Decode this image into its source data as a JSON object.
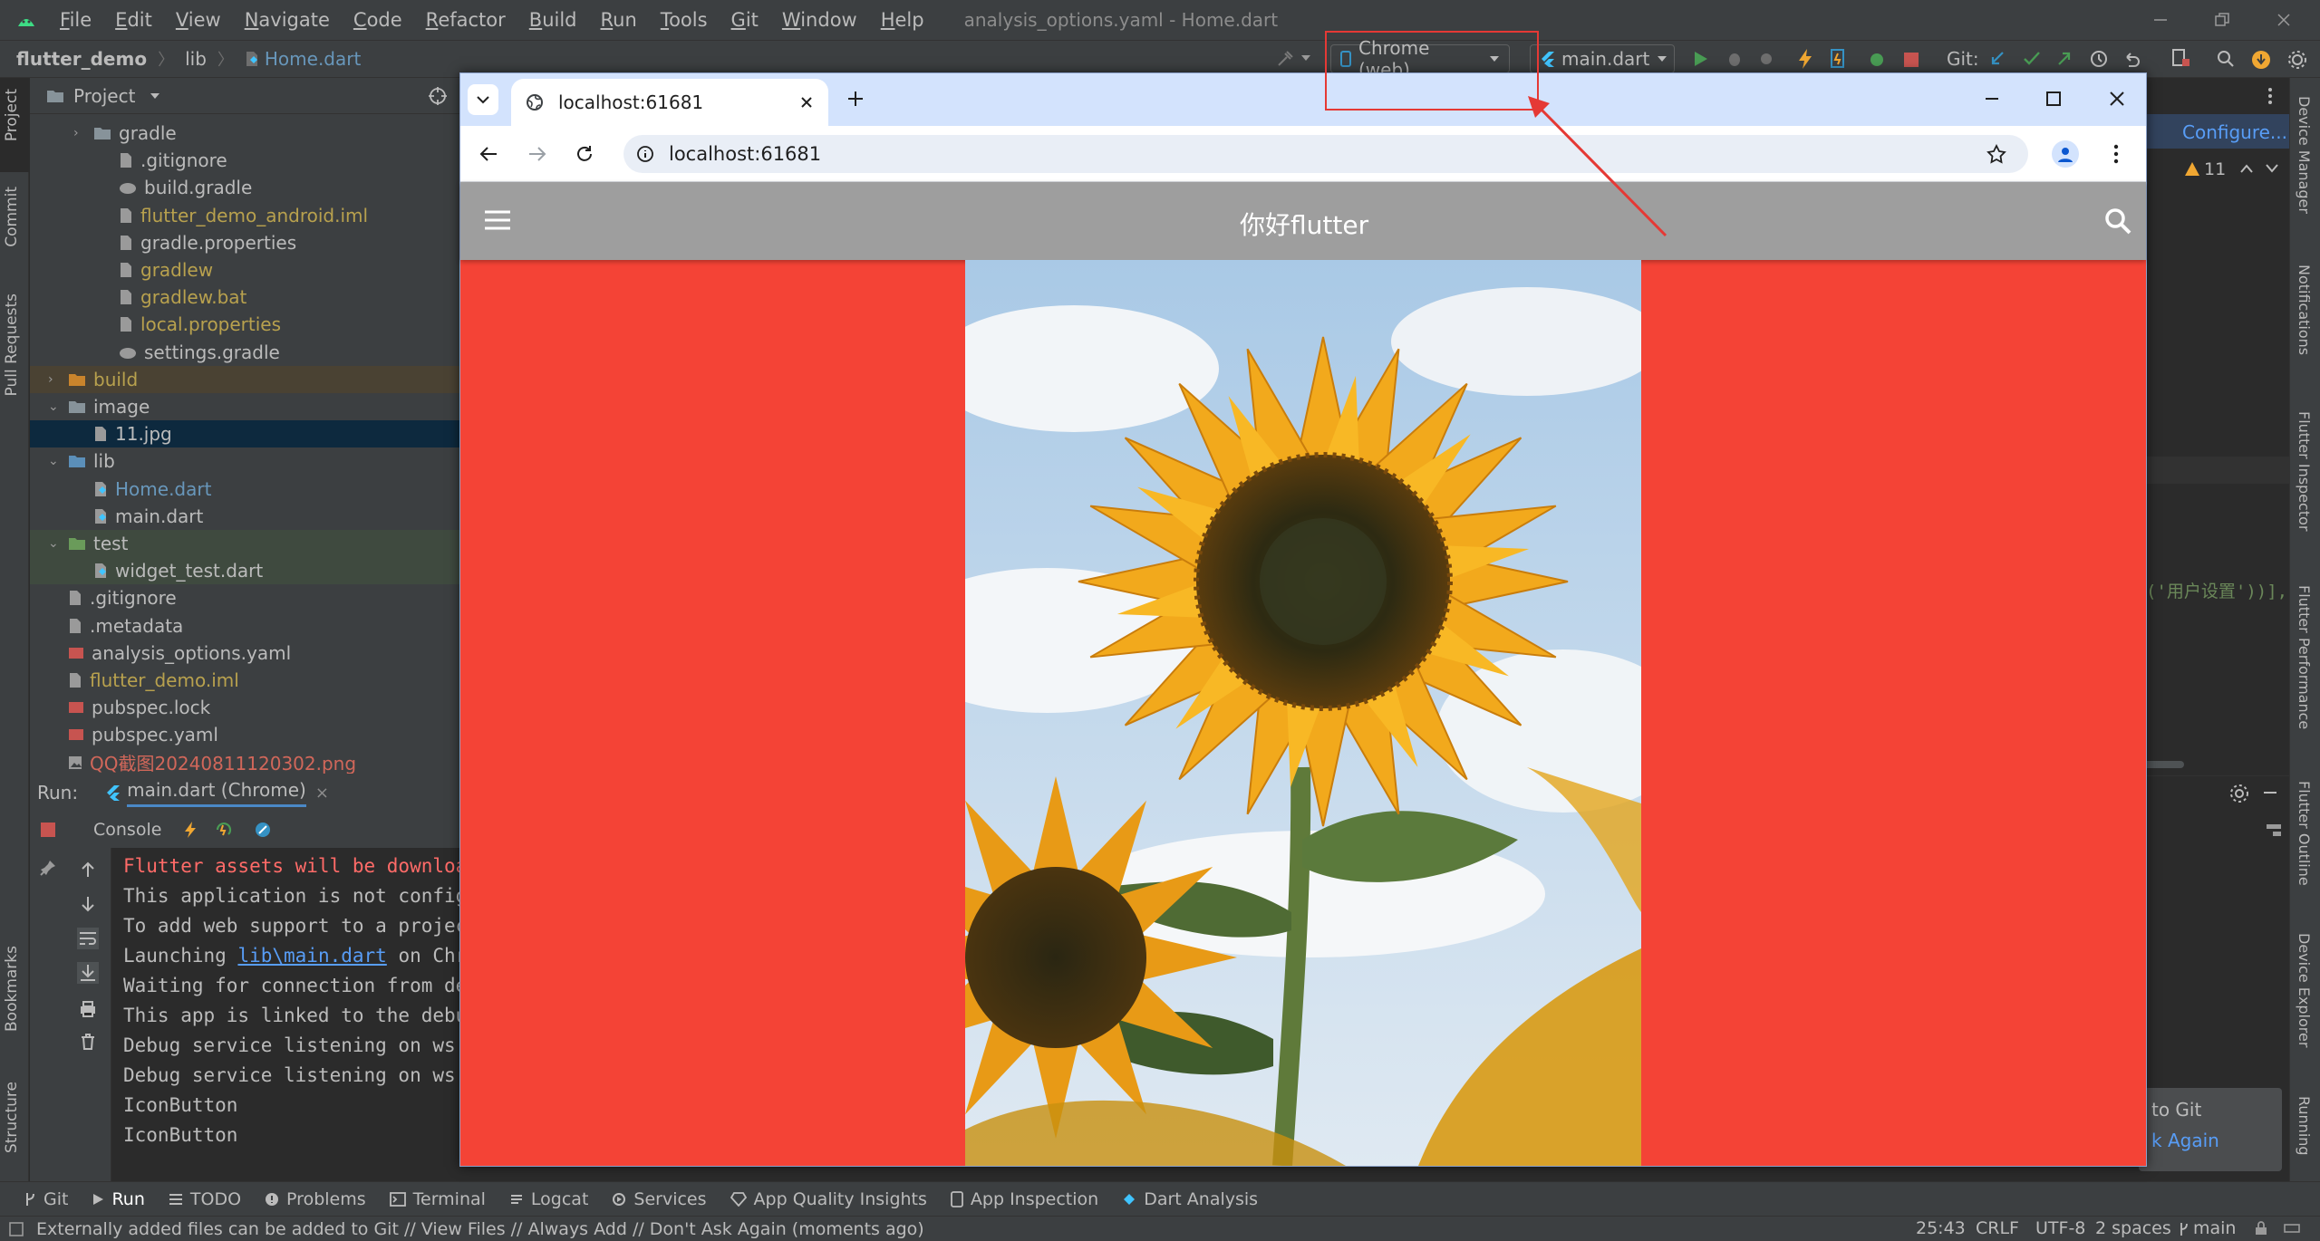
{
  "menu": [
    "File",
    "Edit",
    "View",
    "Navigate",
    "Code",
    "Refactor",
    "Build",
    "Run",
    "Tools",
    "Git",
    "Window",
    "Help"
  ],
  "window_title": "analysis_options.yaml - Home.dart",
  "breadcrumb": {
    "project": "flutter_demo",
    "folder": "lib",
    "file": "Home.dart"
  },
  "toolbar": {
    "device": "Chrome (web)",
    "config": "main.dart",
    "git_label": "Git:"
  },
  "left_stripe": {
    "project": "Project",
    "commit": "Commit",
    "pull_requests": "Pull Requests",
    "bookmarks": "Bookmarks",
    "structure": "Structure"
  },
  "right_stripe": [
    "Device Manager",
    "Notifications",
    "Flutter Inspector",
    "Flutter Performance",
    "Flutter Outline",
    "Device Explorer",
    "Running"
  ],
  "project_panel": {
    "title": "Project",
    "items": [
      {
        "label": "gradle",
        "indent": 1,
        "kind": "folder",
        "arrow": "›",
        "color": "#bbbbbb"
      },
      {
        "label": ".gitignore",
        "indent": 2,
        "kind": "file",
        "color": "#bbbbbb"
      },
      {
        "label": "build.gradle",
        "indent": 2,
        "kind": "gradle",
        "color": "#bbbbbb"
      },
      {
        "label": "flutter_demo_android.iml",
        "indent": 2,
        "kind": "file",
        "color": "#b8a14e"
      },
      {
        "label": "gradle.properties",
        "indent": 2,
        "kind": "file",
        "color": "#bbbbbb"
      },
      {
        "label": "gradlew",
        "indent": 2,
        "kind": "file",
        "color": "#b8a14e"
      },
      {
        "label": "gradlew.bat",
        "indent": 2,
        "kind": "file",
        "color": "#b8a14e"
      },
      {
        "label": "local.properties",
        "indent": 2,
        "kind": "file",
        "color": "#b8a14e"
      },
      {
        "label": "settings.gradle",
        "indent": 2,
        "kind": "gradle",
        "color": "#bbbbbb"
      },
      {
        "label": "build",
        "indent": 0,
        "kind": "folder-orange",
        "arrow": "›",
        "color": "#b8a14e",
        "bg": "#4a4233"
      },
      {
        "label": "image",
        "indent": 0,
        "kind": "folder",
        "arrow": "⌄",
        "color": "#bbbbbb"
      },
      {
        "label": "11.jpg",
        "indent": 1,
        "kind": "file",
        "color": "#bbbbbb",
        "bg": "#0d293e"
      },
      {
        "label": "lib",
        "indent": 0,
        "kind": "folder-blue",
        "arrow": "⌄",
        "color": "#bbbbbb"
      },
      {
        "label": "Home.dart",
        "indent": 1,
        "kind": "dart",
        "color": "#6897bb"
      },
      {
        "label": "main.dart",
        "indent": 1,
        "kind": "dart",
        "color": "#bbbbbb"
      },
      {
        "label": "test",
        "indent": 0,
        "kind": "folder-green",
        "arrow": "⌄",
        "color": "#bbbbbb",
        "bg": "#3f4a3f"
      },
      {
        "label": "widget_test.dart",
        "indent": 1,
        "kind": "dart",
        "color": "#bbbbbb",
        "bg": "#3f4a3f"
      },
      {
        "label": ".gitignore",
        "indent": 0,
        "kind": "file",
        "color": "#bbbbbb"
      },
      {
        "label": ".metadata",
        "indent": 0,
        "kind": "file",
        "color": "#bbbbbb"
      },
      {
        "label": "analysis_options.yaml",
        "indent": 0,
        "kind": "yaml",
        "color": "#bbbbbb"
      },
      {
        "label": "flutter_demo.iml",
        "indent": 0,
        "kind": "file",
        "color": "#b8a14e"
      },
      {
        "label": "pubspec.lock",
        "indent": 0,
        "kind": "yaml",
        "color": "#bbbbbb"
      },
      {
        "label": "pubspec.yaml",
        "indent": 0,
        "kind": "yaml",
        "color": "#bbbbbb"
      },
      {
        "label": "QQ截图20240811120302.png",
        "indent": 0,
        "kind": "image",
        "color": "#d1675a"
      }
    ]
  },
  "run_panel": {
    "run_label": "Run:",
    "tab": "main.dart (Chrome)",
    "console_tab": "Console",
    "lines": [
      {
        "text": "Flutter assets will be download",
        "color": "#ff6b68"
      },
      {
        "text": "This application is not configu",
        "color": "#bbbbbb"
      },
      {
        "text": "To add web support to a project",
        "color": "#bbbbbb"
      },
      {
        "pre": "Launching ",
        "link": "lib\\main.dart",
        "post": " on Chro",
        "color": "#bbbbbb"
      },
      {
        "text": "Waiting for connection from deb",
        "color": "#bbbbbb"
      },
      {
        "text": "This app is linked to the debug",
        "color": "#bbbbbb"
      },
      {
        "text": "Debug service listening on ws:/",
        "color": "#bbbbbb"
      },
      {
        "text": "Debug service listening on ws:/",
        "color": "#bbbbbb"
      },
      {
        "text": "IconButton",
        "color": "#bbbbbb"
      },
      {
        "text": "IconButton",
        "color": "#bbbbbb"
      }
    ]
  },
  "editor_right": {
    "configure": "Configure...",
    "warnings": "11",
    "code_snippet": "('用户设置'))],",
    "notif1": "to Git",
    "notif2": "k Again"
  },
  "browser": {
    "tab_title": "localhost:61681",
    "url": "localhost:61681",
    "app_title": "你好flutter",
    "colors": {
      "tabstrip": "#d3e3fd",
      "appbar": "#9e9e9e",
      "body": "#f44336"
    }
  },
  "bottom_tools": [
    "Git",
    "Run",
    "TODO",
    "Problems",
    "Terminal",
    "Logcat",
    "Services",
    "App Quality Insights",
    "App Inspection",
    "Dart Analysis"
  ],
  "status": {
    "message": "Externally added files can be added to Git // View Files // Always Add // Don't Ask Again (moments ago)",
    "position": "25:43",
    "line_sep": "CRLF",
    "encoding": "UTF-8",
    "indent": "2 spaces",
    "branch": "main"
  }
}
